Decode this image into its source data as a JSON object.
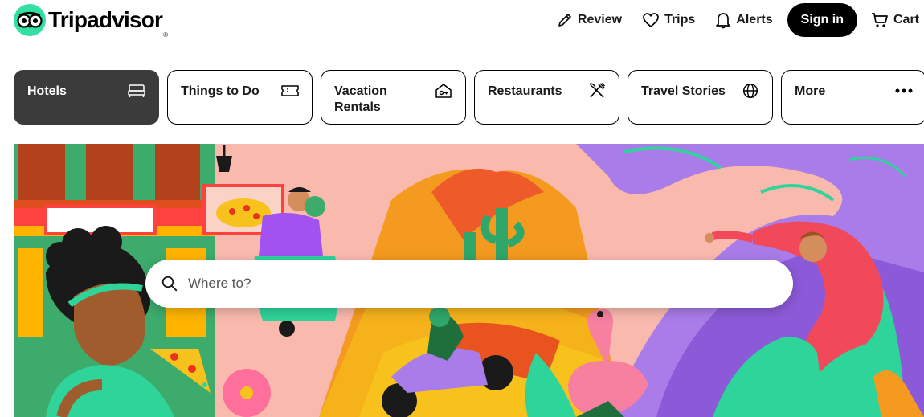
{
  "header": {
    "brand": "Tripadvisor",
    "nav": {
      "review": "Review",
      "trips": "Trips",
      "alerts": "Alerts",
      "sign_in": "Sign in",
      "cart": "Cart"
    }
  },
  "tabs": [
    {
      "label": "Hotels",
      "icon": "bed-icon",
      "active": true
    },
    {
      "label": "Things to Do",
      "icon": "ticket-icon",
      "active": false
    },
    {
      "label": "Vacation Rentals",
      "icon": "house-key-icon",
      "active": false
    },
    {
      "label": "Restaurants",
      "icon": "fork-knife-icon",
      "active": false
    },
    {
      "label": "Travel Stories",
      "icon": "globe-icon",
      "active": false
    },
    {
      "label": "More",
      "icon": "more-dots-icon",
      "active": false
    }
  ],
  "search": {
    "placeholder": "Where to?"
  },
  "colors": {
    "brand_green": "#34e0a1",
    "active_tab": "#3b3b3b",
    "sign_in_bg": "#000000"
  }
}
